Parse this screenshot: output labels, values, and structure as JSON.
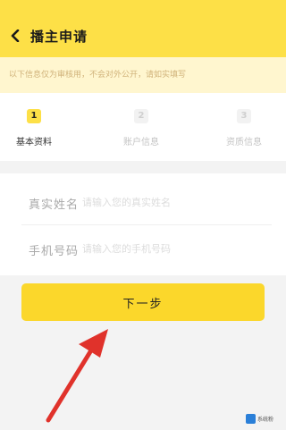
{
  "header": {
    "title": "播主申请",
    "back_icon": "chevron-left-icon",
    "bg_color": "#fde047"
  },
  "notice": {
    "text": "以下信息仅为审核用，不会对外公开，请如实填写"
  },
  "steps": [
    {
      "number": "1",
      "label": "基本资料",
      "active": true
    },
    {
      "number": "2",
      "label": "账户信息",
      "active": false
    },
    {
      "number": "3",
      "label": "资质信息",
      "active": false
    }
  ],
  "form": {
    "name_label": "真实姓名",
    "name_placeholder": "请输入您的真实姓名",
    "phone_label": "手机号码",
    "phone_placeholder": "请输入您的手机号码"
  },
  "actions": {
    "next_label": "下一步",
    "button_color": "#fbd72b"
  },
  "annotation": {
    "arrow_color": "#e0322b",
    "arrow_icon": "red-arrow-icon"
  },
  "watermark": {
    "text": "系统粉"
  }
}
